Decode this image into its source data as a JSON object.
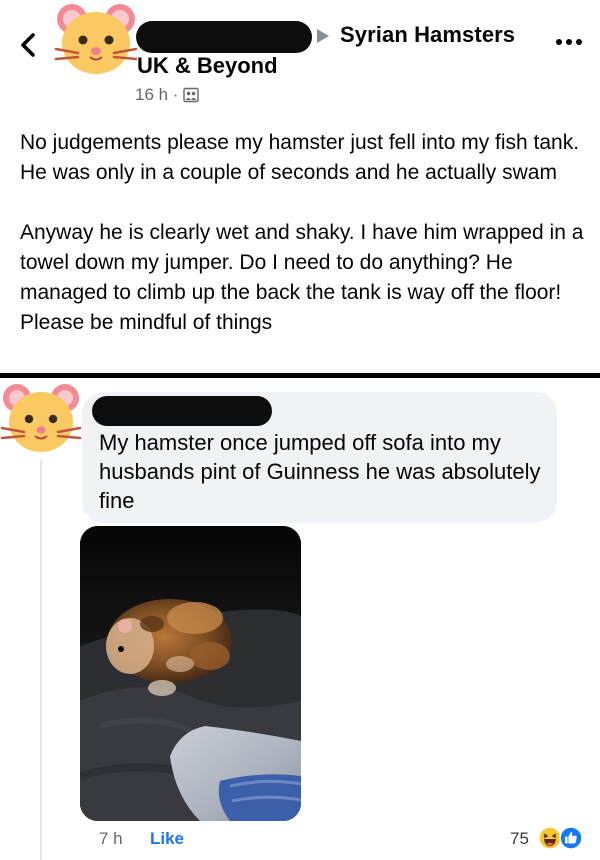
{
  "post": {
    "group_name_line1": "Syrian Hamsters",
    "group_name_line2": "UK & Beyond",
    "time": "16 h ·",
    "avatar": "hamster-face-icon",
    "paragraphs": [
      "No judgements please my hamster just fell into my fish tank. He was only in a couple of seconds and he actually swam",
      "Anyway he is clearly wet and shaky. I have him wrapped in a towel down my jumper. Do I need to do anything? He managed to climb up the back the tank is way off the floor! Please be mindful of things"
    ]
  },
  "comment": {
    "text": "My hamster once jumped off sofa into my husbands pint of Guinness he was absolutely fine",
    "time": "7 h",
    "like_label": "Like",
    "reaction_count": "75",
    "reactions": [
      "haha-icon",
      "like-icon"
    ]
  },
  "colors": {
    "link_blue": "#1877f2",
    "secondary_text": "#65676b",
    "bubble_bg": "#f0f2f5"
  }
}
